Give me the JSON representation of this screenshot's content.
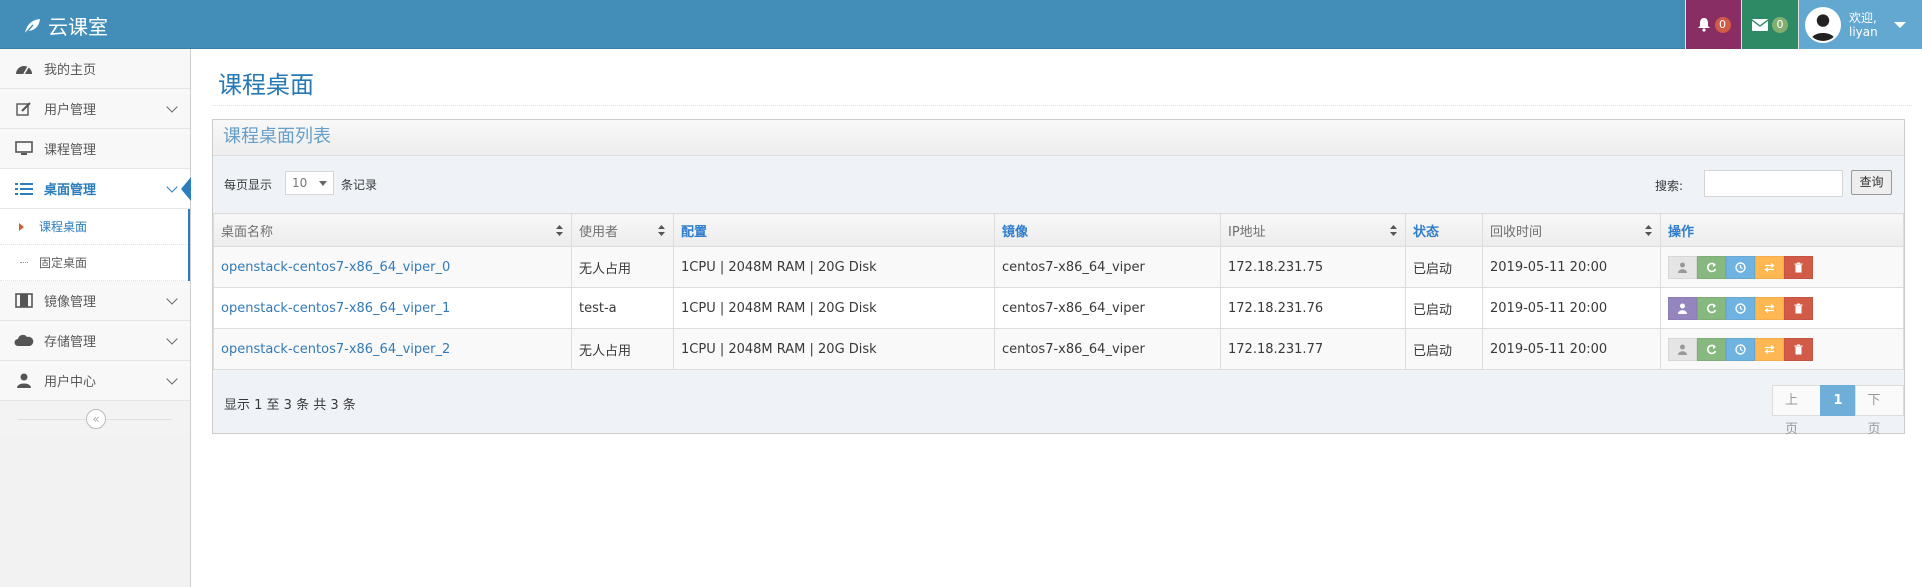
{
  "app": {
    "title": "云课室"
  },
  "topnav": {
    "notifications_count": "0",
    "messages_count": "0",
    "welcome": "欢迎,",
    "username": "liyan"
  },
  "sidebar": {
    "items": [
      {
        "label": "我的主页",
        "icon": "dashboard-icon"
      },
      {
        "label": "用户管理",
        "icon": "edit-icon"
      },
      {
        "label": "课程管理",
        "icon": "desktop-icon"
      },
      {
        "label": "桌面管理",
        "icon": "list-icon"
      },
      {
        "label": "镜像管理",
        "icon": "film-icon"
      },
      {
        "label": "存储管理",
        "icon": "cloud-icon"
      },
      {
        "label": "用户中心",
        "icon": "user-icon"
      }
    ],
    "sub_items": [
      "课程桌面",
      "固定桌面"
    ],
    "collapse_symbol": "«"
  },
  "page": {
    "title": "课程桌面",
    "widget_title": "课程桌面列表",
    "length_prefix": "每页显示",
    "length_value": "10",
    "length_suffix": "条记录",
    "search_label": "搜索:",
    "search_placeholder": "",
    "search_button": "查询",
    "info": "显示 1 至 3 条   共 3 条"
  },
  "table": {
    "headers": [
      "桌面名称",
      "使用者",
      "配置",
      "镜像",
      "IP地址",
      "状态",
      "回收时间",
      "操作"
    ],
    "rows": [
      {
        "name": "openstack-centos7-x86_64_viper_0",
        "user": "无人占用",
        "config": "1CPU | 2048M RAM | 20G Disk",
        "image": "centos7-x86_64_viper",
        "ip": "172.18.231.75",
        "status": "已启动",
        "recycle_time": "2019-05-11 20:00"
      },
      {
        "name": "openstack-centos7-x86_64_viper_1",
        "user": "test-a",
        "config": "1CPU | 2048M RAM | 20G Disk",
        "image": "centos7-x86_64_viper",
        "ip": "172.18.231.76",
        "status": "已启动",
        "recycle_time": "2019-05-11 20:00"
      },
      {
        "name": "openstack-centos7-x86_64_viper_2",
        "user": "无人占用",
        "config": "1CPU | 2048M RAM | 20G Disk",
        "image": "centos7-x86_64_viper",
        "ip": "172.18.231.77",
        "status": "已启动",
        "recycle_time": "2019-05-11 20:00"
      }
    ]
  },
  "pagination": {
    "prev": "上页",
    "current": "1",
    "next": "下页"
  },
  "colors": {
    "navbar": "#438eb9",
    "accent": "#2b7dbc",
    "bell_box": "#892e65",
    "mail_box": "#2e8965",
    "user_box": "#62a8d1",
    "assigned_user_button": "#9585bf",
    "refresh_button": "#87b87f",
    "clock_button": "#6fb3e0",
    "swap_button": "#ffb752",
    "delete_button": "#d15b47"
  }
}
